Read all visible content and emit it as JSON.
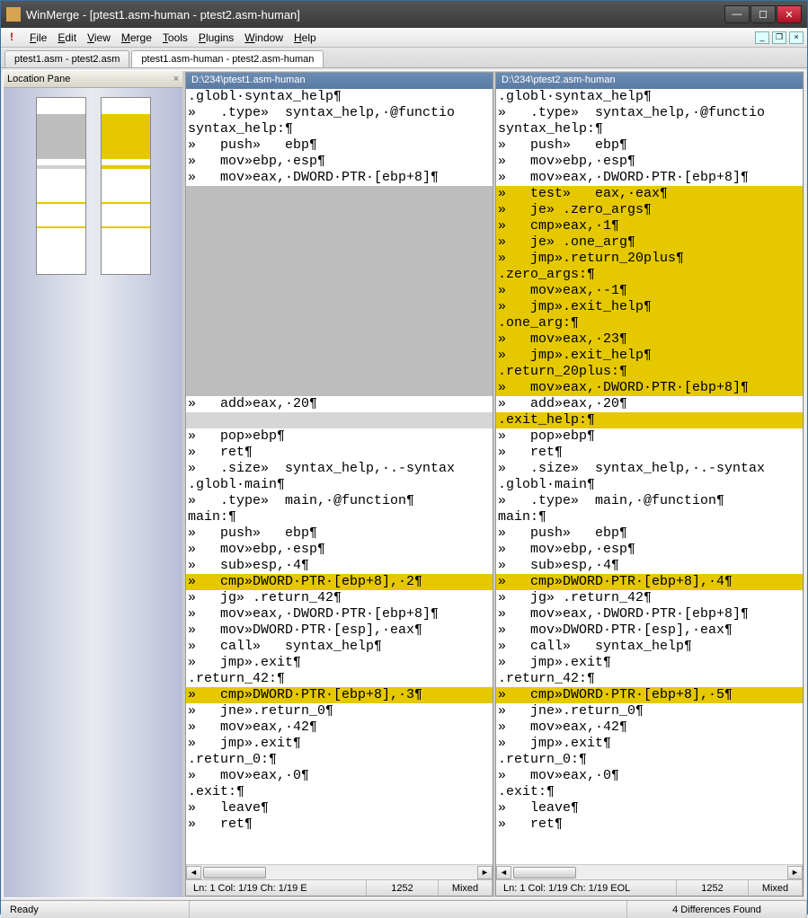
{
  "window": {
    "title": "WinMerge - [ptest1.asm-human - ptest2.asm-human]"
  },
  "menu": {
    "items": [
      "File",
      "Edit",
      "View",
      "Merge",
      "Tools",
      "Plugins",
      "Window",
      "Help"
    ]
  },
  "tabs": [
    {
      "label": "ptest1.asm - ptest2.asm",
      "active": false
    },
    {
      "label": "ptest1.asm-human - ptest2.asm-human",
      "active": true
    }
  ],
  "location_pane": {
    "title": "Location Pane"
  },
  "left": {
    "path": "D:\\234\\ptest1.asm-human",
    "status": {
      "pos": "Ln: 1  Col: 1/19  Ch: 1/19  E",
      "enc": "1252",
      "eol": "Mixed"
    },
    "lines": [
      {
        "t": ".globl·syntax_help¶",
        "c": ""
      },
      {
        "t": "»   .type»  syntax_help,·@functio",
        "c": ""
      },
      {
        "t": "syntax_help:¶",
        "c": ""
      },
      {
        "t": "»   push»   ebp¶",
        "c": ""
      },
      {
        "t": "»   mov»ebp,·esp¶",
        "c": ""
      },
      {
        "t": "»   mov»eax,·DWORD·PTR·[ebp+8]¶",
        "c": ""
      },
      {
        "t": "",
        "c": "gap"
      },
      {
        "t": "",
        "c": "gap"
      },
      {
        "t": "",
        "c": "gap"
      },
      {
        "t": "",
        "c": "gap"
      },
      {
        "t": "",
        "c": "gap"
      },
      {
        "t": "",
        "c": "gap"
      },
      {
        "t": "",
        "c": "gap"
      },
      {
        "t": "",
        "c": "gap"
      },
      {
        "t": "",
        "c": "gap"
      },
      {
        "t": "",
        "c": "gap"
      },
      {
        "t": "",
        "c": "gap"
      },
      {
        "t": "",
        "c": "gap"
      },
      {
        "t": "",
        "c": "gap"
      },
      {
        "t": "»   add»eax,·20¶",
        "c": ""
      },
      {
        "t": "",
        "c": "gaplt"
      },
      {
        "t": "»   pop»ebp¶",
        "c": ""
      },
      {
        "t": "»   ret¶",
        "c": ""
      },
      {
        "t": "»   .size»  syntax_help,·.-syntax",
        "c": ""
      },
      {
        "t": ".globl·main¶",
        "c": ""
      },
      {
        "t": "»   .type»  main,·@function¶",
        "c": ""
      },
      {
        "t": "main:¶",
        "c": ""
      },
      {
        "t": "»   push»   ebp¶",
        "c": ""
      },
      {
        "t": "»   mov»ebp,·esp¶",
        "c": ""
      },
      {
        "t": "»   sub»esp,·4¶",
        "c": ""
      },
      {
        "t": "»   cmp»DWORD·PTR·[ebp+8],·2¶",
        "c": "diff"
      },
      {
        "t": "»   jg» .return_42¶",
        "c": ""
      },
      {
        "t": "»   mov»eax,·DWORD·PTR·[ebp+8]¶",
        "c": ""
      },
      {
        "t": "»   mov»DWORD·PTR·[esp],·eax¶",
        "c": ""
      },
      {
        "t": "»   call»   syntax_help¶",
        "c": ""
      },
      {
        "t": "»   jmp».exit¶",
        "c": ""
      },
      {
        "t": ".return_42:¶",
        "c": ""
      },
      {
        "t": "»   cmp»DWORD·PTR·[ebp+8],·3¶",
        "c": "diff"
      },
      {
        "t": "»   jne».return_0¶",
        "c": ""
      },
      {
        "t": "»   mov»eax,·42¶",
        "c": ""
      },
      {
        "t": "»   jmp».exit¶",
        "c": ""
      },
      {
        "t": ".return_0:¶",
        "c": ""
      },
      {
        "t": "»   mov»eax,·0¶",
        "c": ""
      },
      {
        "t": ".exit:¶",
        "c": ""
      },
      {
        "t": "»   leave¶",
        "c": ""
      },
      {
        "t": "»   ret¶",
        "c": ""
      }
    ]
  },
  "right": {
    "path": "D:\\234\\ptest2.asm-human",
    "status": {
      "pos": "Ln: 1  Col: 1/19  Ch: 1/19  EOL",
      "enc": "1252",
      "eol": "Mixed"
    },
    "lines": [
      {
        "t": ".globl·syntax_help¶",
        "c": ""
      },
      {
        "t": "»   .type»  syntax_help,·@functio",
        "c": ""
      },
      {
        "t": "syntax_help:¶",
        "c": ""
      },
      {
        "t": "»   push»   ebp¶",
        "c": ""
      },
      {
        "t": "»   mov»ebp,·esp¶",
        "c": ""
      },
      {
        "t": "»   mov»eax,·DWORD·PTR·[ebp+8]¶",
        "c": ""
      },
      {
        "t": "»   test»   eax,·eax¶",
        "c": "diff"
      },
      {
        "t": "»   je» .zero_args¶",
        "c": "diff"
      },
      {
        "t": "»   cmp»eax,·1¶",
        "c": "diff"
      },
      {
        "t": "»   je» .one_arg¶",
        "c": "diff"
      },
      {
        "t": "»   jmp».return_20plus¶",
        "c": "diff"
      },
      {
        "t": ".zero_args:¶",
        "c": "diff"
      },
      {
        "t": "»   mov»eax,·-1¶",
        "c": "diff"
      },
      {
        "t": "»   jmp».exit_help¶",
        "c": "diff"
      },
      {
        "t": ".one_arg:¶",
        "c": "diff"
      },
      {
        "t": "»   mov»eax,·23¶",
        "c": "diff"
      },
      {
        "t": "»   jmp».exit_help¶",
        "c": "diff"
      },
      {
        "t": ".return_20plus:¶",
        "c": "diff"
      },
      {
        "t": "»   mov»eax,·DWORD·PTR·[ebp+8]¶",
        "c": "diff"
      },
      {
        "t": "»   add»eax,·20¶",
        "c": ""
      },
      {
        "t": ".exit_help:¶",
        "c": "diff"
      },
      {
        "t": "»   pop»ebp¶",
        "c": ""
      },
      {
        "t": "»   ret¶",
        "c": ""
      },
      {
        "t": "»   .size»  syntax_help,·.-syntax",
        "c": ""
      },
      {
        "t": ".globl·main¶",
        "c": ""
      },
      {
        "t": "»   .type»  main,·@function¶",
        "c": ""
      },
      {
        "t": "main:¶",
        "c": ""
      },
      {
        "t": "»   push»   ebp¶",
        "c": ""
      },
      {
        "t": "»   mov»ebp,·esp¶",
        "c": ""
      },
      {
        "t": "»   sub»esp,·4¶",
        "c": ""
      },
      {
        "t": "»   cmp»DWORD·PTR·[ebp+8],·4¶",
        "c": "diff"
      },
      {
        "t": "»   jg» .return_42¶",
        "c": ""
      },
      {
        "t": "»   mov»eax,·DWORD·PTR·[ebp+8]¶",
        "c": ""
      },
      {
        "t": "»   mov»DWORD·PTR·[esp],·eax¶",
        "c": ""
      },
      {
        "t": "»   call»   syntax_help¶",
        "c": ""
      },
      {
        "t": "»   jmp».exit¶",
        "c": ""
      },
      {
        "t": ".return_42:¶",
        "c": ""
      },
      {
        "t": "»   cmp»DWORD·PTR·[ebp+8],·5¶",
        "c": "diff"
      },
      {
        "t": "»   jne».return_0¶",
        "c": ""
      },
      {
        "t": "»   mov»eax,·42¶",
        "c": ""
      },
      {
        "t": "»   jmp».exit¶",
        "c": ""
      },
      {
        "t": ".return_0:¶",
        "c": ""
      },
      {
        "t": "»   mov»eax,·0¶",
        "c": ""
      },
      {
        "t": ".exit:¶",
        "c": ""
      },
      {
        "t": "»   leave¶",
        "c": ""
      },
      {
        "t": "»   ret¶",
        "c": ""
      }
    ]
  },
  "statusbar": {
    "ready": "Ready",
    "diffs": "4 Differences Found"
  }
}
